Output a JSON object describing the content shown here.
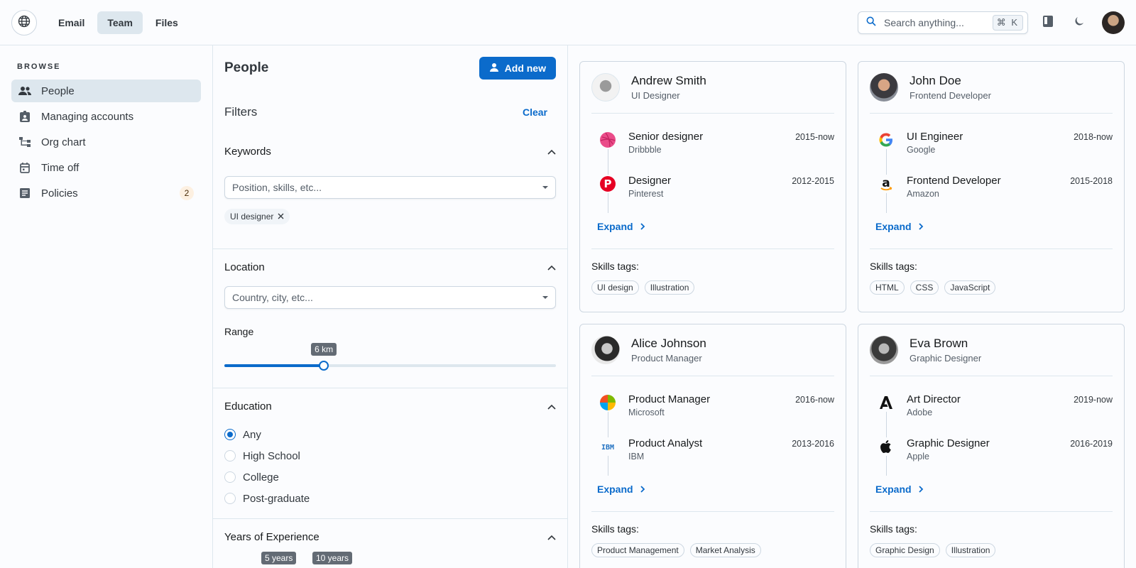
{
  "header": {
    "tabs": [
      {
        "label": "Email",
        "active": false
      },
      {
        "label": "Team",
        "active": true
      },
      {
        "label": "Files",
        "active": false
      }
    ],
    "search": {
      "placeholder": "Search anything...",
      "shortcut": "⌘ K"
    },
    "icons": [
      "globe-icon",
      "search-icon",
      "book-icon",
      "moon-icon"
    ]
  },
  "sidebar": {
    "section_label": "BROWSE",
    "items": [
      {
        "label": "People",
        "icon": "people-icon",
        "active": true
      },
      {
        "label": "Managing accounts",
        "icon": "badge-icon",
        "active": false
      },
      {
        "label": "Org chart",
        "icon": "org-chart-icon",
        "active": false
      },
      {
        "label": "Time off",
        "icon": "calendar-icon",
        "active": false
      },
      {
        "label": "Policies",
        "icon": "article-icon",
        "active": false,
        "badge": "2"
      }
    ]
  },
  "filters": {
    "page_title": "People",
    "add_button": "Add new",
    "title": "Filters",
    "clear_label": "Clear",
    "keywords": {
      "title": "Keywords",
      "placeholder": "Position, skills, etc...",
      "chip": "UI designer"
    },
    "location": {
      "title": "Location",
      "placeholder": "Country, city, etc...",
      "range_label": "Range",
      "range_value": "6 km",
      "range_fraction": 0.3
    },
    "education": {
      "title": "Education",
      "options": [
        {
          "label": "Any",
          "checked": true
        },
        {
          "label": "High School",
          "checked": false
        },
        {
          "label": "College",
          "checked": false
        },
        {
          "label": "Post-graduate",
          "checked": false
        }
      ]
    },
    "experience": {
      "title": "Years of Experience",
      "min_label": "5 years",
      "max_label": "10 years"
    }
  },
  "cards": [
    {
      "name": "Andrew Smith",
      "role": "UI Designer",
      "jobs": [
        {
          "title": "Senior designer",
          "company": "Dribbble",
          "years": "2015-now",
          "logo": "dribbble-logo"
        },
        {
          "title": "Designer",
          "company": "Pinterest",
          "years": "2012-2015",
          "logo": "pinterest-logo"
        }
      ],
      "expand_label": "Expand",
      "skills_label": "Skills tags:",
      "skills": [
        "UI design",
        "Illustration"
      ]
    },
    {
      "name": "John Doe",
      "role": "Frontend Developer",
      "jobs": [
        {
          "title": "UI Engineer",
          "company": "Google",
          "years": "2018-now",
          "logo": "google-logo"
        },
        {
          "title": "Frontend Developer",
          "company": "Amazon",
          "years": "2015-2018",
          "logo": "amazon-logo"
        }
      ],
      "expand_label": "Expand",
      "skills_label": "Skills tags:",
      "skills": [
        "HTML",
        "CSS",
        "JavaScript"
      ]
    },
    {
      "name": "Alice Johnson",
      "role": "Product Manager",
      "jobs": [
        {
          "title": "Product Manager",
          "company": "Microsoft",
          "years": "2016-now",
          "logo": "microsoft-logo"
        },
        {
          "title": "Product Analyst",
          "company": "IBM",
          "years": "2013-2016",
          "logo": "ibm-logo"
        }
      ],
      "expand_label": "Expand",
      "skills_label": "Skills tags:",
      "skills": [
        "Product Management",
        "Market Analysis"
      ]
    },
    {
      "name": "Eva Brown",
      "role": "Graphic Designer",
      "jobs": [
        {
          "title": "Art Director",
          "company": "Adobe",
          "years": "2019-now",
          "logo": "adobe-logo"
        },
        {
          "title": "Graphic Designer",
          "company": "Apple",
          "years": "2016-2019",
          "logo": "apple-logo"
        }
      ],
      "expand_label": "Expand",
      "skills_label": "Skills tags:",
      "skills": [
        "Graphic Design",
        "Illustration"
      ]
    }
  ],
  "colors": {
    "primary": "#0b6bcb",
    "border": "#cdd7e1",
    "divider": "#dde7ee",
    "active_bg": "#dde7ee"
  }
}
